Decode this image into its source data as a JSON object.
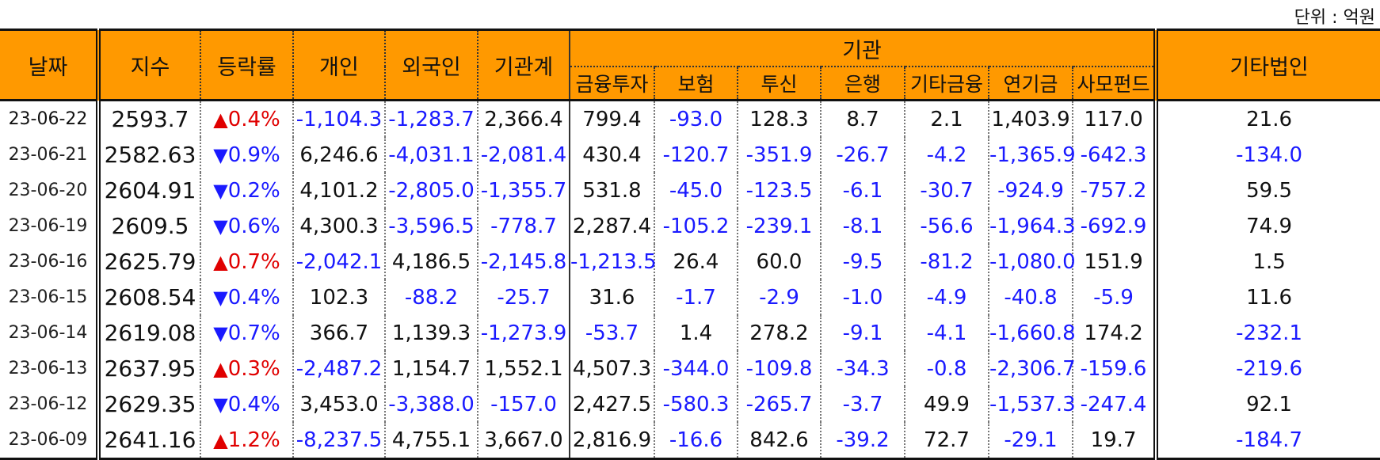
{
  "unit_label": "단위 : 억원",
  "headers": {
    "date": "날짜",
    "index": "지수",
    "change": "등락률",
    "individual": "개인",
    "foreign": "외국인",
    "institution_total": "기관계",
    "institution": "기관",
    "financial_investment": "금융투자",
    "insurance": "보험",
    "investment_trust": "투신",
    "bank": "은행",
    "other_financial": "기타금융",
    "pension": "연기금",
    "private_fund": "사모펀드",
    "other_corp": "기타법인"
  },
  "rows": [
    {
      "date": "23-06-22",
      "index": "2593.7",
      "dir": "up",
      "arrow": "▲",
      "change": "0.4%",
      "individual": "-1,104.3",
      "foreign": "-1,283.7",
      "institution_total": "2,366.4",
      "financial_investment": "799.4",
      "insurance": "-93.0",
      "investment_trust": "128.3",
      "bank": "8.7",
      "other_financial": "2.1",
      "pension": "1,403.9",
      "private_fund": "117.0",
      "other_corp": "21.6"
    },
    {
      "date": "23-06-21",
      "index": "2582.63",
      "dir": "down",
      "arrow": "▼",
      "change": "0.9%",
      "individual": "6,246.6",
      "foreign": "-4,031.1",
      "institution_total": "-2,081.4",
      "financial_investment": "430.4",
      "insurance": "-120.7",
      "investment_trust": "-351.9",
      "bank": "-26.7",
      "other_financial": "-4.2",
      "pension": "-1,365.9",
      "private_fund": "-642.3",
      "other_corp": "-134.0"
    },
    {
      "date": "23-06-20",
      "index": "2604.91",
      "dir": "down",
      "arrow": "▼",
      "change": "0.2%",
      "individual": "4,101.2",
      "foreign": "-2,805.0",
      "institution_total": "-1,355.7",
      "financial_investment": "531.8",
      "insurance": "-45.0",
      "investment_trust": "-123.5",
      "bank": "-6.1",
      "other_financial": "-30.7",
      "pension": "-924.9",
      "private_fund": "-757.2",
      "other_corp": "59.5"
    },
    {
      "date": "23-06-19",
      "index": "2609.5",
      "dir": "down",
      "arrow": "▼",
      "change": "0.6%",
      "individual": "4,300.3",
      "foreign": "-3,596.5",
      "institution_total": "-778.7",
      "financial_investment": "2,287.4",
      "insurance": "-105.2",
      "investment_trust": "-239.1",
      "bank": "-8.1",
      "other_financial": "-56.6",
      "pension": "-1,964.3",
      "private_fund": "-692.9",
      "other_corp": "74.9"
    },
    {
      "date": "23-06-16",
      "index": "2625.79",
      "dir": "up",
      "arrow": "▲",
      "change": "0.7%",
      "individual": "-2,042.1",
      "foreign": "4,186.5",
      "institution_total": "-2,145.8",
      "financial_investment": "-1,213.5",
      "insurance": "26.4",
      "investment_trust": "60.0",
      "bank": "-9.5",
      "other_financial": "-81.2",
      "pension": "-1,080.0",
      "private_fund": "151.9",
      "other_corp": "1.5"
    },
    {
      "date": "23-06-15",
      "index": "2608.54",
      "dir": "down",
      "arrow": "▼",
      "change": "0.4%",
      "individual": "102.3",
      "foreign": "-88.2",
      "institution_total": "-25.7",
      "financial_investment": "31.6",
      "insurance": "-1.7",
      "investment_trust": "-2.9",
      "bank": "-1.0",
      "other_financial": "-4.9",
      "pension": "-40.8",
      "private_fund": "-5.9",
      "other_corp": "11.6"
    },
    {
      "date": "23-06-14",
      "index": "2619.08",
      "dir": "down",
      "arrow": "▼",
      "change": "0.7%",
      "individual": "366.7",
      "foreign": "1,139.3",
      "institution_total": "-1,273.9",
      "financial_investment": "-53.7",
      "insurance": "1.4",
      "investment_trust": "278.2",
      "bank": "-9.1",
      "other_financial": "-4.1",
      "pension": "-1,660.8",
      "private_fund": "174.2",
      "other_corp": "-232.1"
    },
    {
      "date": "23-06-13",
      "index": "2637.95",
      "dir": "up",
      "arrow": "▲",
      "change": "0.3%",
      "individual": "-2,487.2",
      "foreign": "1,154.7",
      "institution_total": "1,552.1",
      "financial_investment": "4,507.3",
      "insurance": "-344.0",
      "investment_trust": "-109.8",
      "bank": "-34.3",
      "other_financial": "-0.8",
      "pension": "-2,306.7",
      "private_fund": "-159.6",
      "other_corp": "-219.6"
    },
    {
      "date": "23-06-12",
      "index": "2629.35",
      "dir": "down",
      "arrow": "▼",
      "change": "0.4%",
      "individual": "3,453.0",
      "foreign": "-3,388.0",
      "institution_total": "-157.0",
      "financial_investment": "2,427.5",
      "insurance": "-580.3",
      "investment_trust": "-265.7",
      "bank": "-3.7",
      "other_financial": "49.9",
      "pension": "-1,537.3",
      "private_fund": "-247.4",
      "other_corp": "92.1"
    },
    {
      "date": "23-06-09",
      "index": "2641.16",
      "dir": "up",
      "arrow": "▲",
      "change": "1.2%",
      "individual": "-8,237.5",
      "foreign": "4,755.1",
      "institution_total": "3,667.0",
      "financial_investment": "2,816.9",
      "insurance": "-16.6",
      "investment_trust": "842.6",
      "bank": "-39.2",
      "other_financial": "72.7",
      "pension": "-29.1",
      "private_fund": "19.7",
      "other_corp": "-184.7"
    }
  ],
  "colors": {
    "header_bg": "#ff9900",
    "negative": "#1a1aff",
    "up": "#e00000",
    "down": "#1a1aff"
  }
}
